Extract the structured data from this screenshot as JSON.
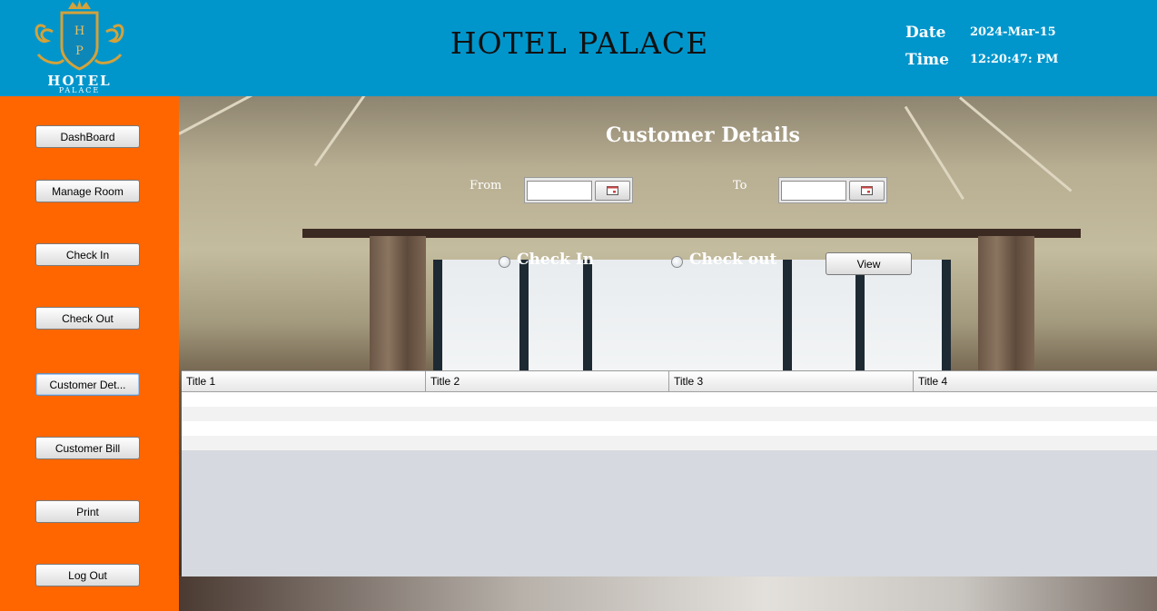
{
  "header": {
    "logo": {
      "initials": [
        "H",
        "P"
      ],
      "name": "HOTEL",
      "sub": "PALACE"
    },
    "title": "HOTEL PALACE",
    "date_label": "Date",
    "date_value": "2024-Mar-15",
    "time_label": "Time",
    "time_value": "12:20:47: PM"
  },
  "sidebar": {
    "items": [
      {
        "label": "DashBoard"
      },
      {
        "label": "Manage Room"
      },
      {
        "label": "Check In"
      },
      {
        "label": "Check Out"
      },
      {
        "label": "Customer Det..."
      },
      {
        "label": "Customer Bill"
      },
      {
        "label": "Print"
      },
      {
        "label": "Log Out"
      }
    ],
    "active_index": 4
  },
  "main": {
    "title": "Customer Details",
    "from_label": "From",
    "to_label": "To",
    "from_value": "",
    "to_value": "",
    "radio_checkin": "Check In",
    "radio_checkout": "Check out",
    "view_button": "View",
    "table": {
      "columns": [
        "Title 1",
        "Title 2",
        "Title 3",
        "Title 4"
      ],
      "rows": [
        [
          "",
          "",
          "",
          ""
        ],
        [
          "",
          "",
          "",
          ""
        ],
        [
          "",
          "",
          "",
          ""
        ],
        [
          "",
          "",
          "",
          ""
        ]
      ]
    }
  },
  "colors": {
    "header_bg": "#0096CC",
    "sidebar_bg": "#FF6600",
    "logo_gold": "#D4A23A"
  }
}
